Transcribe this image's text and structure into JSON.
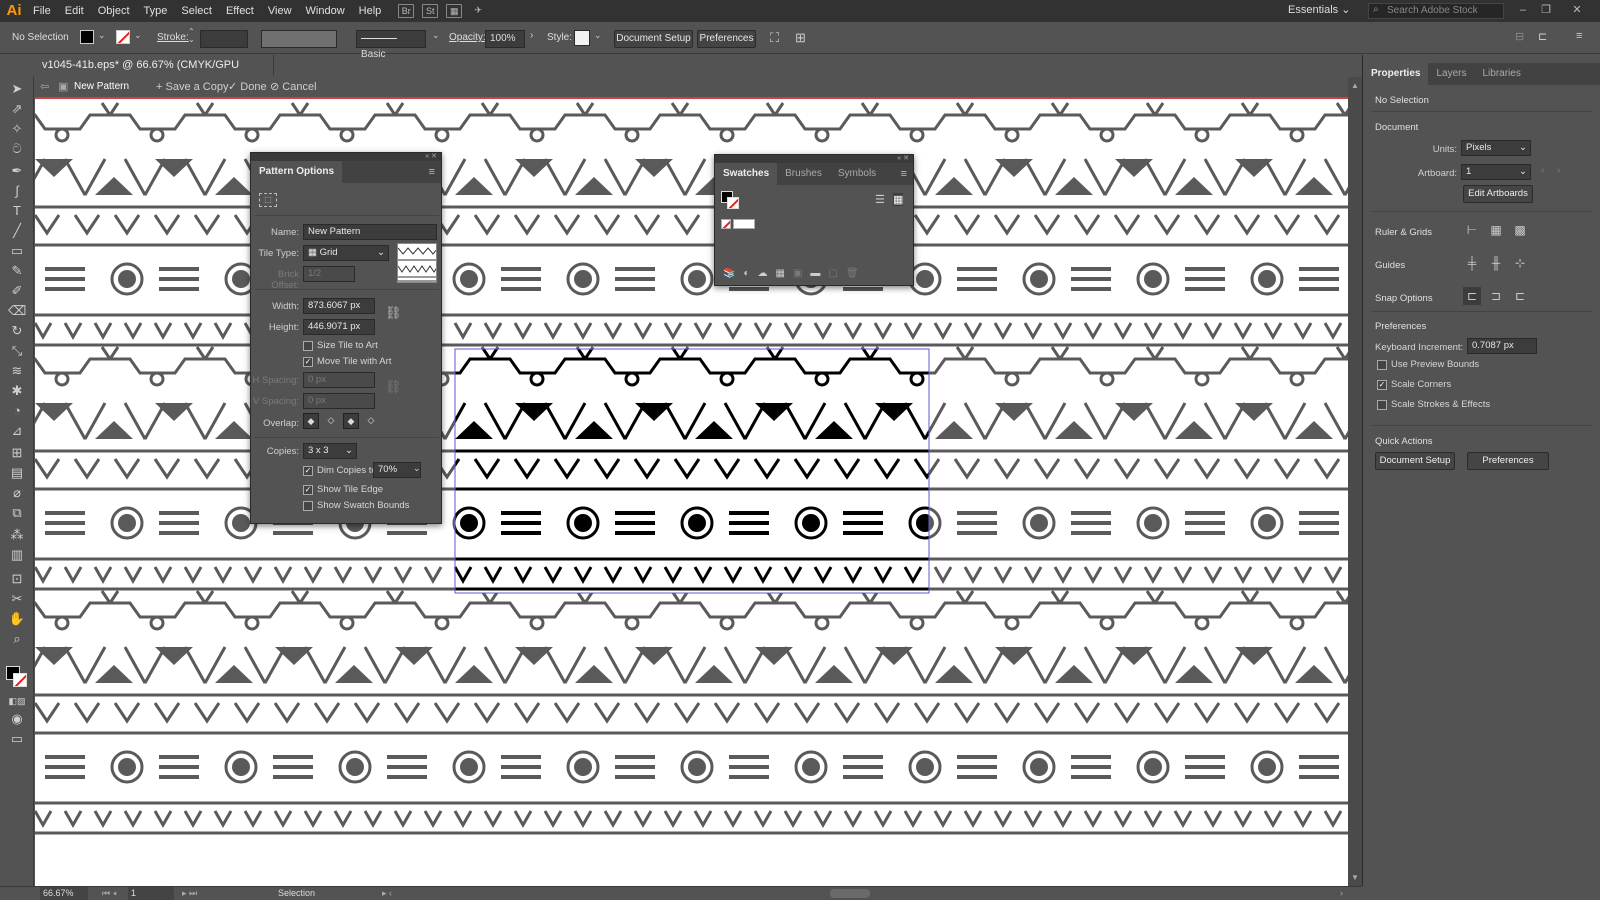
{
  "app": {
    "logo": "Ai"
  },
  "menu": [
    "File",
    "Edit",
    "Object",
    "Type",
    "Select",
    "Effect",
    "View",
    "Window",
    "Help"
  ],
  "menubar_icons": [
    "bridge-icon",
    "stock-icon",
    "arrange-documents-icon",
    "gpu-icon"
  ],
  "workspace": "Essentials",
  "search": {
    "placeholder": "Search Adobe Stock"
  },
  "control": {
    "selection": "No Selection",
    "stroke_label": "Stroke:",
    "brush": "Basic",
    "opacity_label": "Opacity:",
    "opacity": "100%",
    "style_label": "Style:",
    "doc_setup": "Document Setup",
    "preferences": "Preferences"
  },
  "document": {
    "tab": "v1045-41b.eps* @ 66.67% (CMYK/GPU Preview)",
    "close": "×"
  },
  "pattern_bar": {
    "name": "New Pattern",
    "save_copy": "Save a Copy",
    "done": "Done",
    "cancel": "Cancel"
  },
  "pattern_options": {
    "title": "Pattern Options",
    "name_label": "Name:",
    "name": "New Pattern",
    "tile_type_label": "Tile Type:",
    "tile_type": "Grid",
    "brick_offset_label": "Brick Offset:",
    "brick_offset": "1/2",
    "width_label": "Width:",
    "width": "873.6067 px",
    "height_label": "Height:",
    "height": "446.9071 px",
    "size_tile": "Size Tile to Art",
    "size_tile_checked": false,
    "move_tile": "Move Tile with Art",
    "move_tile_checked": true,
    "h_spacing_label": "H Spacing:",
    "h_spacing": "0 px",
    "v_spacing_label": "V Spacing:",
    "v_spacing": "0 px",
    "overlap_label": "Overlap:",
    "copies_label": "Copies:",
    "copies": "3 x 3",
    "dim_copies": "Dim Copies to:",
    "dim_copies_value": "70%",
    "dim_copies_checked": true,
    "show_tile_edge": "Show Tile Edge",
    "show_tile_edge_checked": true,
    "show_swatch_bounds": "Show Swatch Bounds",
    "show_swatch_bounds_checked": false
  },
  "swatches_panel": {
    "tabs": [
      "Swatches",
      "Brushes",
      "Symbols"
    ]
  },
  "right_panel": {
    "tabs": [
      "Properties",
      "Layers",
      "Libraries"
    ],
    "selection": "No Selection",
    "document_head": "Document",
    "units_label": "Units:",
    "units": "Pixels",
    "artboard_label": "Artboard:",
    "artboard": "1",
    "edit_artboards": "Edit Artboards",
    "ruler_grids": "Ruler & Grids",
    "guides": "Guides",
    "snap_options": "Snap Options",
    "preferences_head": "Preferences",
    "keyboard_increment_label": "Keyboard Increment:",
    "keyboard_increment": "0.7087 px",
    "use_preview_bounds": "Use Preview Bounds",
    "use_preview_bounds_checked": false,
    "scale_corners": "Scale Corners",
    "scale_corners_checked": true,
    "scale_strokes": "Scale Strokes & Effects",
    "scale_strokes_checked": false,
    "quick_actions": "Quick Actions",
    "qa_doc_setup": "Document Setup",
    "qa_preferences": "Preferences"
  },
  "status": {
    "zoom": "66.67%",
    "artboard": "1",
    "tool": "Selection"
  },
  "colors": {
    "pattern_dim": "#5a5a5a",
    "pattern_tile": "#000000",
    "tile_edge": "#5b5bd6"
  }
}
